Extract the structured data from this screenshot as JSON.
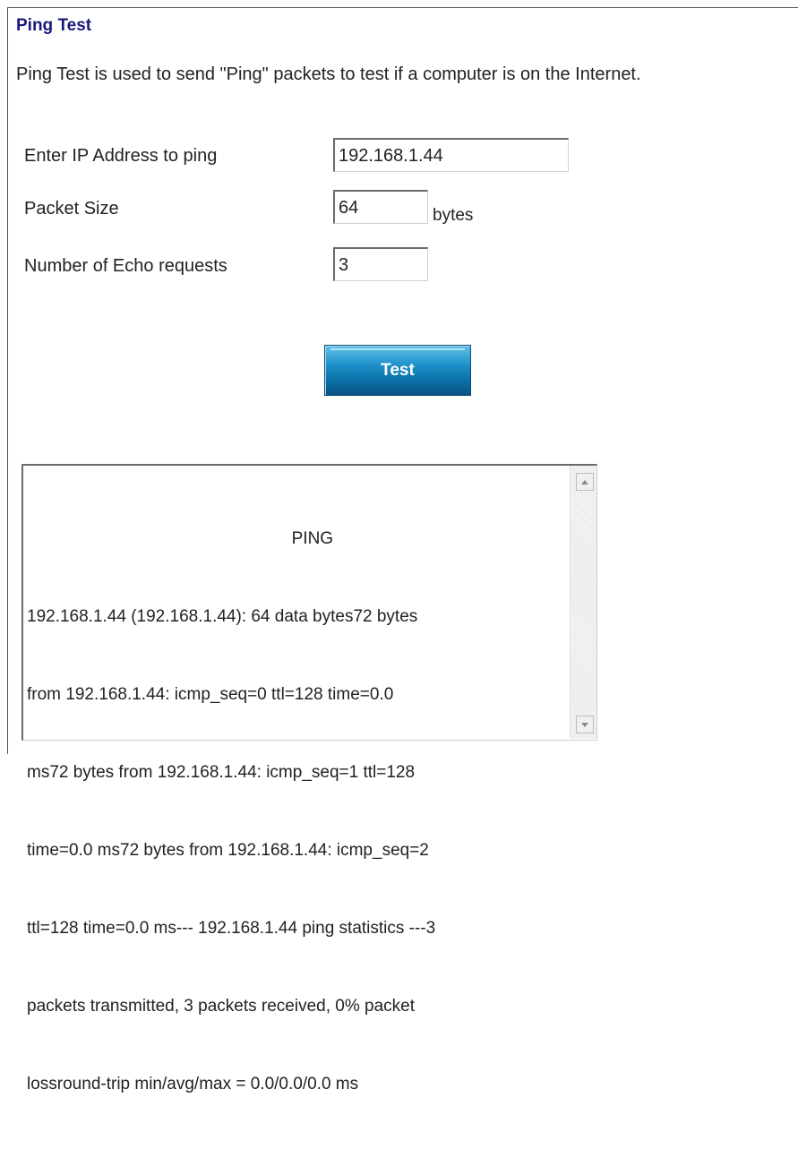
{
  "page": {
    "title": "Ping Test",
    "description": "Ping Test is used to send \"Ping\" packets to test if a computer is on the Internet."
  },
  "form": {
    "ip_label": "Enter IP Address to ping",
    "ip_value": "192.168.1.44",
    "size_label": "Packet Size",
    "size_value": "64",
    "size_unit": "bytes",
    "echo_label": "Number of Echo requests",
    "echo_value": "3"
  },
  "actions": {
    "test_label": "Test"
  },
  "output": {
    "lines": [
      "                                                        PING",
      "192.168.1.44 (192.168.1.44): 64 data bytes72 bytes",
      "from 192.168.1.44: icmp_seq=0 ttl=128 time=0.0",
      "ms72 bytes from 192.168.1.44: icmp_seq=1 ttl=128",
      "time=0.0 ms72 bytes from 192.168.1.44: icmp_seq=2",
      "ttl=128 time=0.0 ms--- 192.168.1.44 ping statistics ---3",
      "packets transmitted, 3 packets received, 0% packet",
      "lossround-trip min/avg/max = 0.0/0.0/0.0 ms"
    ]
  },
  "colors": {
    "title": "#1a1a7a",
    "button_top": "#63c0e6",
    "button_bottom": "#085283"
  }
}
